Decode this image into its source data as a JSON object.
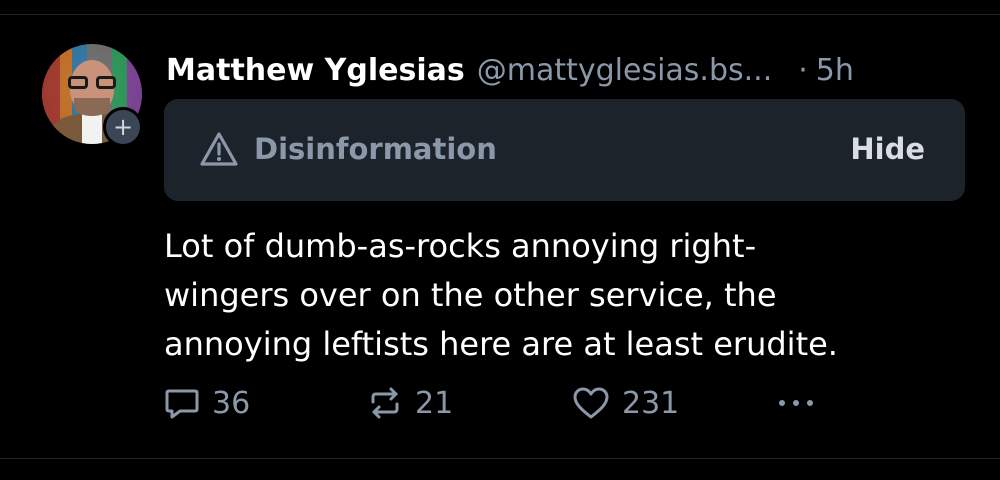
{
  "post": {
    "author_name": "Matthew Yglesias",
    "author_handle": "@mattyglesias.bs...",
    "separator": "·",
    "time": "5h",
    "avatar_icon": "author-avatar",
    "follow_icon": "plus-icon",
    "follow_symbol": "+",
    "label": {
      "icon": "warning-triangle-icon",
      "text": "Disinformation",
      "action": "Hide"
    },
    "text_lines": [
      "Lot of dumb-as-rocks annoying right-",
      "wingers over on the other service, the",
      "annoying leftists here are at least erudite."
    ],
    "actions": {
      "reply": {
        "icon": "reply-icon",
        "count": "36"
      },
      "repost": {
        "icon": "repost-icon",
        "count": "21"
      },
      "like": {
        "icon": "heart-icon",
        "count": "231"
      },
      "more": {
        "icon": "more-horizontal-icon"
      }
    }
  },
  "colors": {
    "background": "#000000",
    "text_primary": "#ffffff",
    "text_secondary": "#8b98a9",
    "label_bg": "#1d232b",
    "divider": "#1f2630"
  }
}
